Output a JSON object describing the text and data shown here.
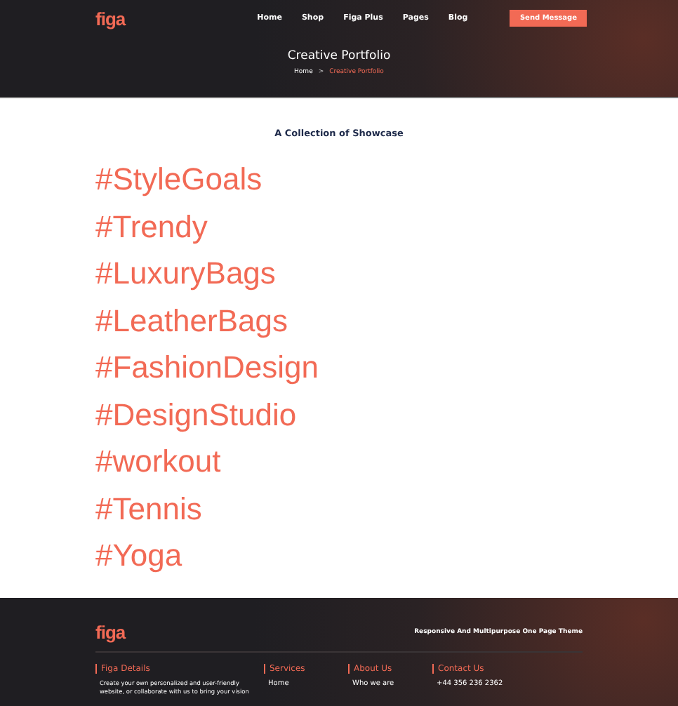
{
  "header": {
    "logo": "figa",
    "nav": [
      {
        "label": "Home",
        "selected": false
      },
      {
        "label": "Shop",
        "selected": false
      },
      {
        "label": "Figa Plus",
        "selected": false
      },
      {
        "label": "Pages",
        "selected": false
      },
      {
        "label": "Blog",
        "selected": false
      }
    ],
    "cta": "Send Message",
    "title": "Creative Portfolio",
    "breadcrumb": [
      {
        "label": "Home",
        "selected": false
      },
      {
        "label": "Creative Portfolio",
        "selected": true
      }
    ],
    "breadcrumb_separator": ">"
  },
  "subtitle": "A Collection of Showcase",
  "hashtags": [
    "#StyleGoals",
    "#Trendy",
    "#LuxuryBags",
    "#LeatherBags",
    "#FashionDesign",
    "#DesignStudio",
    "#workout",
    "#Tennis",
    "#Yoga"
  ],
  "footer": {
    "logo": "figa",
    "tagline": "Responsive And Multipurpose One Page Theme",
    "columns": [
      {
        "heading": "Figa Details",
        "kind": "text",
        "lines": [
          "Create your own personalized and user-friendly",
          "website, or collaborate with us to bring your vision"
        ]
      },
      {
        "heading": "Services",
        "kind": "links",
        "lines": [
          "Home"
        ]
      },
      {
        "heading": "About Us",
        "kind": "links",
        "lines": [
          "Who we are"
        ]
      },
      {
        "heading": "Contact Us",
        "kind": "links",
        "lines": [
          "+44 356 236 2362"
        ]
      }
    ]
  }
}
